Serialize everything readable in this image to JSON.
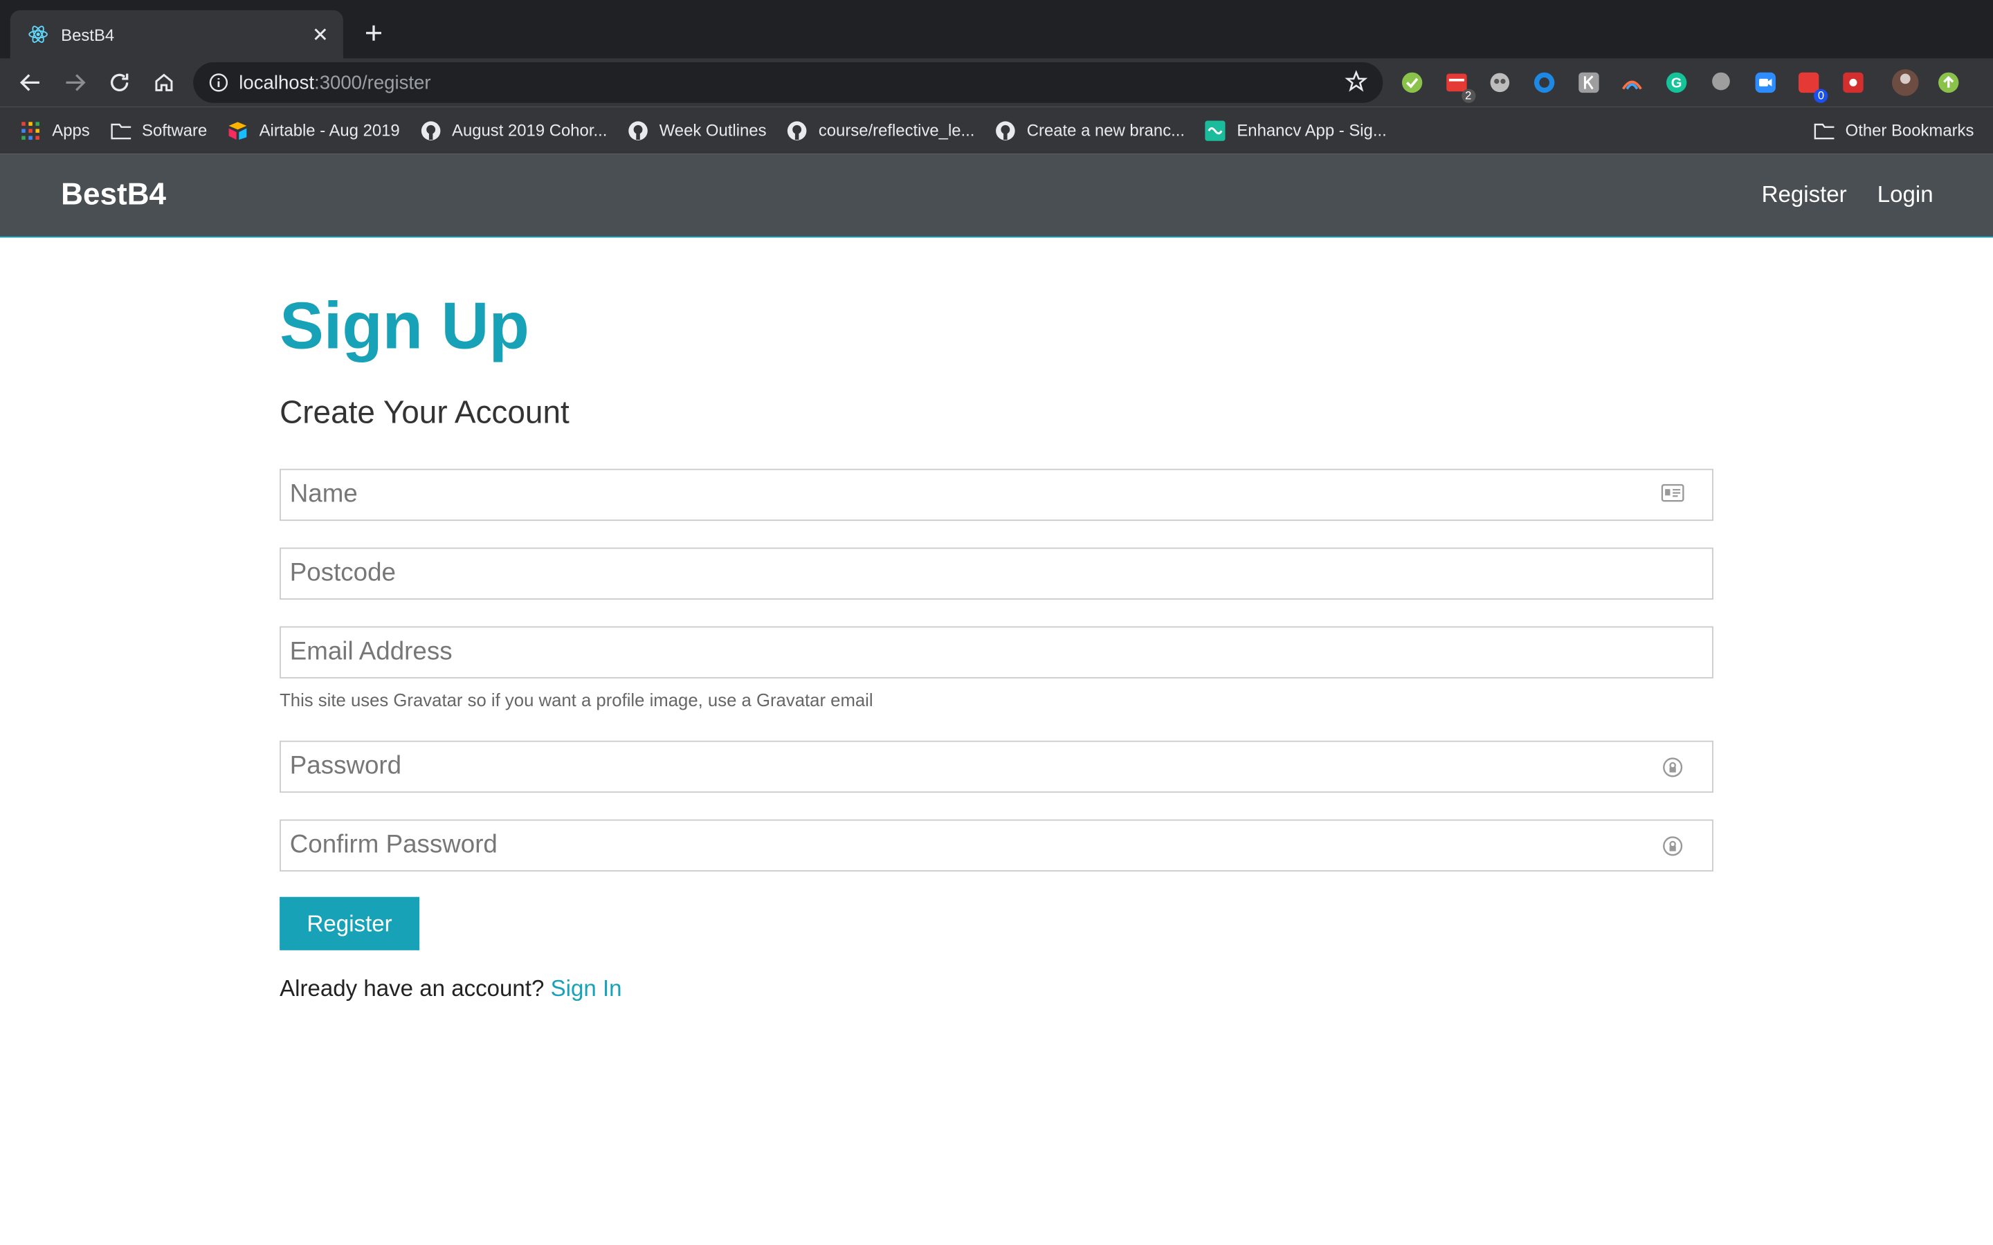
{
  "browser": {
    "tab_title": "BestB4",
    "url_host": "localhost",
    "url_path": ":3000/register",
    "extension_badges": {
      "ext2": "2",
      "ext11": "0"
    },
    "bookmarks": [
      {
        "label": "Apps",
        "icon": "apps-grid-icon"
      },
      {
        "label": "Software",
        "icon": "folder-icon"
      },
      {
        "label": "Airtable - Aug 2019",
        "icon": "airtable-icon"
      },
      {
        "label": "August 2019 Cohor...",
        "icon": "github-icon"
      },
      {
        "label": "Week Outlines",
        "icon": "github-icon"
      },
      {
        "label": "course/reflective_le...",
        "icon": "github-icon"
      },
      {
        "label": "Create a new branc...",
        "icon": "github-icon"
      },
      {
        "label": "Enhancv App - Sig...",
        "icon": "enhancv-icon"
      }
    ],
    "other_bookmarks": "Other Bookmarks"
  },
  "navbar": {
    "brand": "BestB4",
    "links": [
      "Register",
      "Login"
    ]
  },
  "page": {
    "title": "Sign Up",
    "subtitle": "Create Your Account",
    "fields": {
      "name": {
        "placeholder": "Name",
        "value": ""
      },
      "postcode": {
        "placeholder": "Postcode",
        "value": ""
      },
      "email": {
        "placeholder": "Email Address",
        "value": ""
      },
      "password": {
        "placeholder": "Password",
        "value": ""
      },
      "confirm": {
        "placeholder": "Confirm Password",
        "value": ""
      }
    },
    "email_hint": "This site uses Gravatar so if you want a profile image, use a Gravatar email",
    "submit_label": "Register",
    "signin_prompt": "Already have an account? ",
    "signin_link": "Sign In"
  },
  "colors": {
    "accent": "#17a2b8",
    "navbar_bg": "#4a4f54",
    "chrome_dark": "#202124",
    "chrome_toolbar": "#35363a"
  }
}
